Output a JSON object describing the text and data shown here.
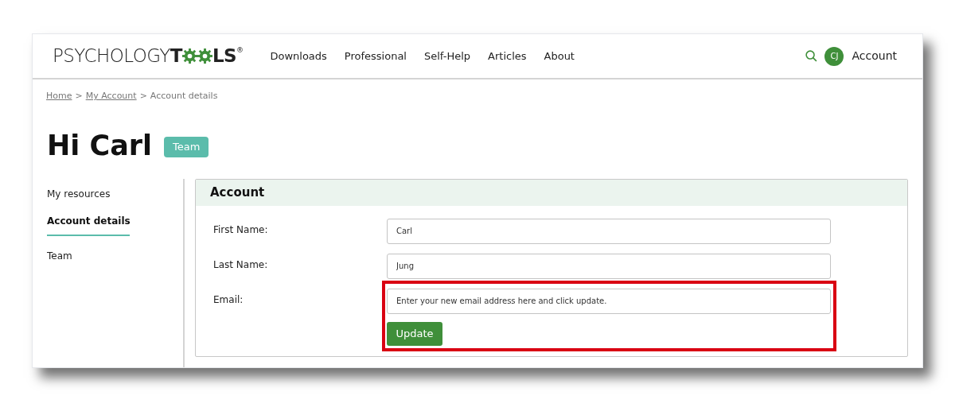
{
  "logo": {
    "light": "PSYCHOLOGY",
    "bold_start": "T",
    "bold_end": "LS",
    "mark": "®"
  },
  "nav": [
    "Downloads",
    "Professional",
    "Self-Help",
    "Articles",
    "About"
  ],
  "account": {
    "initials": "CJ",
    "label": "Account"
  },
  "breadcrumb": [
    {
      "label": "Home",
      "kind": "link"
    },
    {
      "label": ">",
      "kind": "sep"
    },
    {
      "label": "My Account",
      "kind": "link"
    },
    {
      "label": ">",
      "kind": "sep"
    },
    {
      "label": "Account details",
      "kind": "current"
    }
  ],
  "heading": "Hi Carl",
  "badge": "Team",
  "sidebar": [
    {
      "label": "My resources",
      "selected": false
    },
    {
      "label": "Account details",
      "selected": true
    },
    {
      "label": "Team",
      "selected": false
    }
  ],
  "panel": {
    "title": "Account",
    "fields": [
      {
        "label": "First Name:",
        "value": "Carl"
      },
      {
        "label": "Last Name:",
        "value": "Jung"
      },
      {
        "label": "Email:",
        "placeholder": "Enter your new email address here and click update.",
        "highlighted": true
      }
    ],
    "button": "Update"
  }
}
